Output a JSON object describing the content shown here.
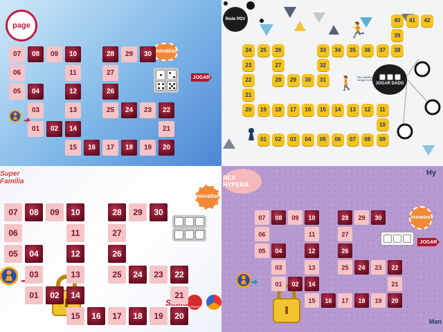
{
  "panels": [
    {
      "id": "q1",
      "logo": "page",
      "start_label": "01",
      "victory": "PARABÉNS",
      "roll_label": "JOGAR"
    },
    {
      "id": "q2",
      "logo": "Rede PDV",
      "roll_label": "JOGAR DADO",
      "hint": "Seu objetivo é chegar ao final"
    },
    {
      "id": "q3",
      "logo": "Super Família",
      "victory": "PARABÉNS",
      "brands": [
        "Sadia",
        "PERDIGÃO"
      ]
    },
    {
      "id": "q4",
      "logo": "REV HYPERA",
      "victory": "PARABÉNS",
      "roll_label": "JOGAR",
      "brand_top": "Hy",
      "brand_bottom": "Man"
    }
  ],
  "red_board_numbers": [
    "01",
    "02",
    "03",
    "04",
    "05",
    "06",
    "07",
    "08",
    "09",
    "10",
    "11",
    "12",
    "13",
    "14",
    "15",
    "16",
    "17",
    "18",
    "19",
    "20",
    "21",
    "22",
    "23",
    "24",
    "25",
    "26",
    "27",
    "28",
    "29",
    "30"
  ],
  "yellow_board_numbers": [
    "01",
    "02",
    "03",
    "04",
    "05",
    "06",
    "07",
    "08",
    "09",
    "10",
    "11",
    "12",
    "13",
    "14",
    "15",
    "16",
    "17",
    "18",
    "19",
    "20",
    "21",
    "22",
    "23",
    "24",
    "25",
    "26",
    "27",
    "28",
    "29",
    "30",
    "31",
    "32",
    "33",
    "34",
    "35",
    "36",
    "37",
    "38",
    "39",
    "40",
    "41",
    "42"
  ],
  "colors": {
    "tile_light": "#f5c4c6",
    "tile_dark": "#8a1a30",
    "yellow": "#f6c21d",
    "navy": "#1d3767",
    "button": "#b0182e",
    "victory": "#f08a3a"
  }
}
